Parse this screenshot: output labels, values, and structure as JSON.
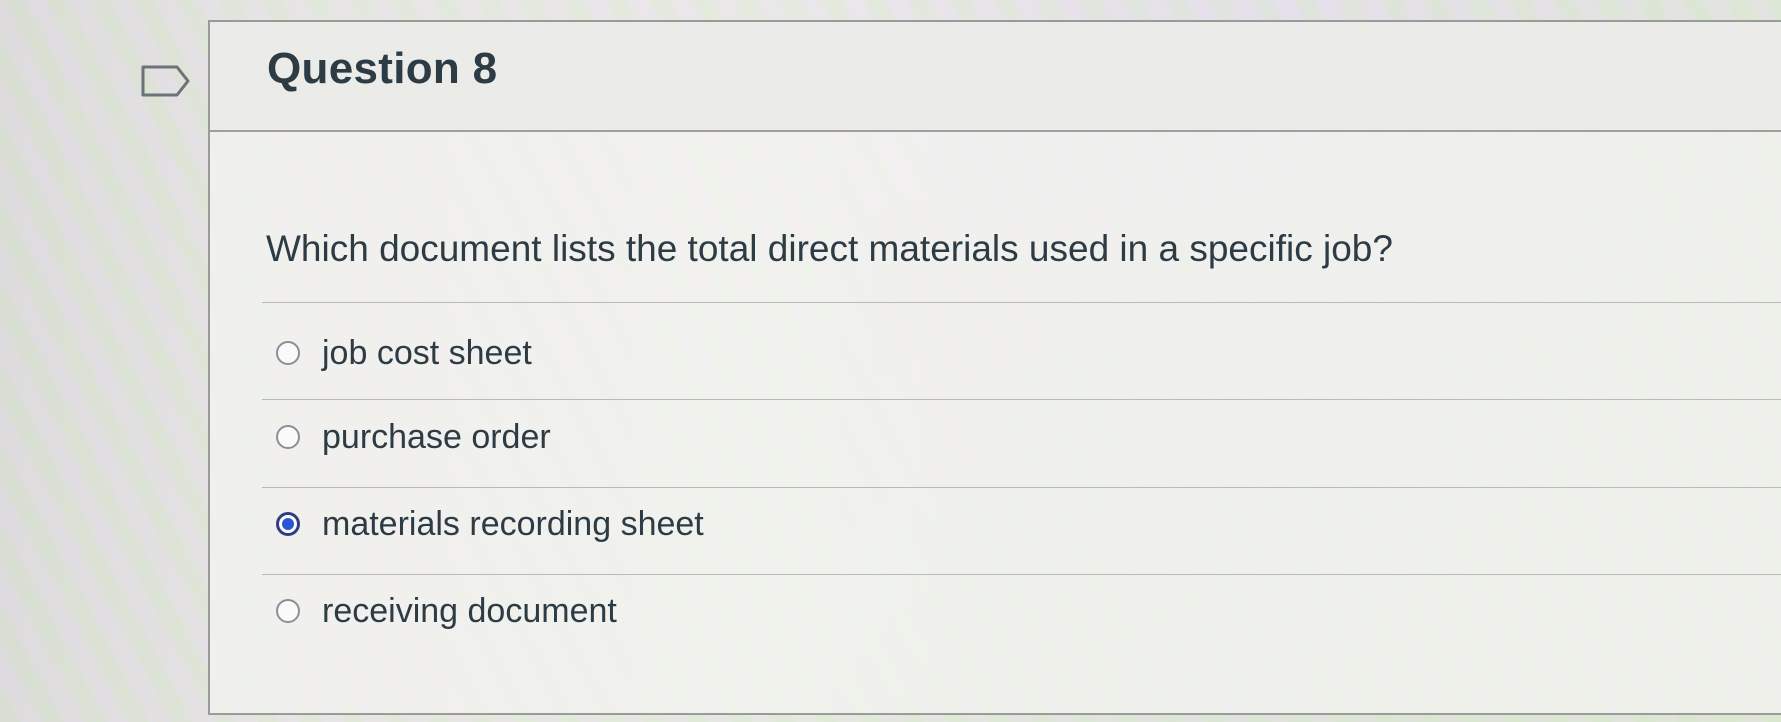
{
  "question": {
    "title": "Question 8",
    "prompt": "Which document lists the total direct materials used in a specific job?",
    "answers": [
      {
        "label": "job cost sheet",
        "selected": false
      },
      {
        "label": "purchase order",
        "selected": false
      },
      {
        "label": "materials recording sheet",
        "selected": true
      },
      {
        "label": "receiving document",
        "selected": false
      }
    ]
  },
  "icons": {
    "flag": "flag-question-icon"
  },
  "colors": {
    "text": "#2d3b45",
    "selected_radio": "#2b55d8"
  }
}
